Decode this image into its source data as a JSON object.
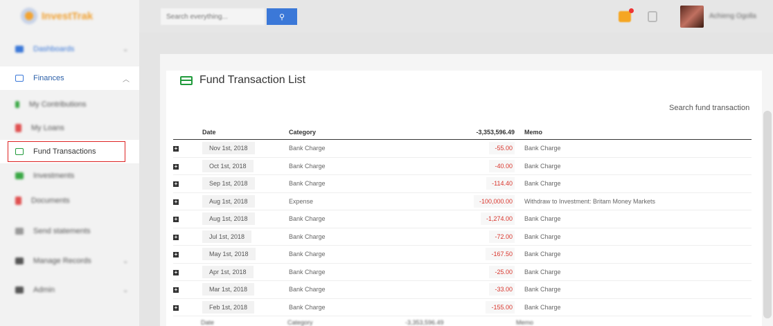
{
  "app": {
    "logo_text": "InvestTrak"
  },
  "topbar": {
    "search_placeholder": "Search everything...",
    "search_button_icon": "search-icon",
    "username": "Achieng Ogolla"
  },
  "sidebar": {
    "items": [
      {
        "label": "Dashboards",
        "icon": "dashboard-icon",
        "color": "#3b78d8"
      },
      {
        "label": "Finances",
        "icon": "money-icon",
        "color": "#3b78d8"
      },
      {
        "label": "My Contributions",
        "icon": "contribution-icon",
        "color": "#3aa845"
      },
      {
        "label": "My Loans",
        "icon": "loan-icon",
        "color": "#e05050"
      },
      {
        "label": "Fund Transactions",
        "icon": "card-icon",
        "color": "#1f9a3a"
      },
      {
        "label": "Investments",
        "icon": "investment-icon",
        "color": "#3aa845"
      },
      {
        "label": "Documents",
        "icon": "document-icon",
        "color": "#e05050"
      },
      {
        "label": "Send statements",
        "icon": "send-icon",
        "color": "#888888"
      },
      {
        "label": "Manage Records",
        "icon": "records-icon",
        "color": "#555555"
      },
      {
        "label": "Admin",
        "icon": "admin-icon",
        "color": "#555555"
      }
    ]
  },
  "page": {
    "title": "Fund Transaction List",
    "search_label": "Search fund transaction"
  },
  "table": {
    "headers": {
      "date": "Date",
      "category": "Category",
      "amount_total": "-3,353,596.49",
      "memo": "Memo"
    },
    "rows": [
      {
        "date": "Nov 1st, 2018",
        "category": "Bank Charge",
        "amount": "-55.00",
        "memo": "Bank Charge"
      },
      {
        "date": "Oct 1st, 2018",
        "category": "Bank Charge",
        "amount": "-40.00",
        "memo": "Bank Charge"
      },
      {
        "date": "Sep 1st, 2018",
        "category": "Bank Charge",
        "amount": "-114.40",
        "memo": "Bank Charge"
      },
      {
        "date": "Aug 1st, 2018",
        "category": "Expense",
        "amount": "-100,000.00",
        "memo": "Withdraw to Investment: Britam Money Markets"
      },
      {
        "date": "Aug 1st, 2018",
        "category": "Bank Charge",
        "amount": "-1,274.00",
        "memo": "Bank Charge"
      },
      {
        "date": "Jul 1st, 2018",
        "category": "Bank Charge",
        "amount": "-72.00",
        "memo": "Bank Charge"
      },
      {
        "date": "May 1st, 2018",
        "category": "Bank Charge",
        "amount": "-167.50",
        "memo": "Bank Charge"
      },
      {
        "date": "Apr 1st, 2018",
        "category": "Bank Charge",
        "amount": "-25.00",
        "memo": "Bank Charge"
      },
      {
        "date": "Mar 1st, 2018",
        "category": "Bank Charge",
        "amount": "-33.00",
        "memo": "Bank Charge"
      },
      {
        "date": "Feb 1st, 2018",
        "category": "Bank Charge",
        "amount": "-155.00",
        "memo": "Bank Charge"
      }
    ],
    "footer": {
      "date": "Date",
      "category": "Category",
      "amount_total": "-3,353,596.49",
      "memo": "Memo"
    }
  },
  "colors": {
    "accent": "#3b78d8",
    "negative": "#d9342b",
    "highlight_border": "#dd2222"
  }
}
